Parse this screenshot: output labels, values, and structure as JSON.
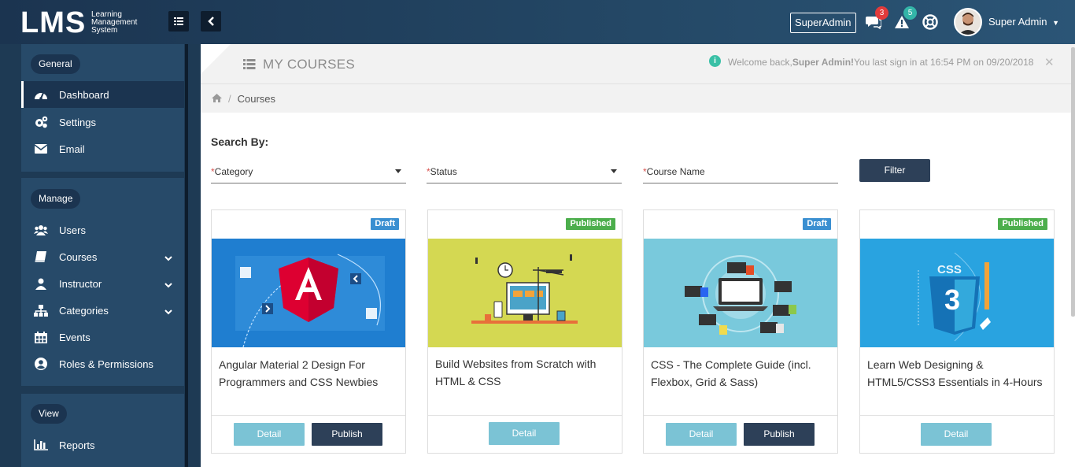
{
  "brand": {
    "logo": "LMS",
    "tagline": [
      "Learning",
      "Management",
      "System"
    ]
  },
  "topbar": {
    "role_label": "SuperAdmin",
    "messages_count": "3",
    "alerts_count": "5",
    "user_name": "Super Admin",
    "colors": {
      "messages_badge": "#e23b3b",
      "alerts_badge": "#33b5a8"
    }
  },
  "sidebar": {
    "groups": [
      {
        "title": "General",
        "items": [
          {
            "label": "Dashboard",
            "icon": "dashboard-icon",
            "active": true
          },
          {
            "label": "Settings",
            "icon": "gears-icon"
          },
          {
            "label": "Email",
            "icon": "envelope-icon"
          }
        ]
      },
      {
        "title": "Manage",
        "items": [
          {
            "label": "Users",
            "icon": "users-icon"
          },
          {
            "label": "Courses",
            "icon": "book-icon",
            "has_children": true
          },
          {
            "label": "Instructor",
            "icon": "user-icon",
            "has_children": true
          },
          {
            "label": "Categories",
            "icon": "sitemap-icon",
            "has_children": true
          },
          {
            "label": "Events",
            "icon": "calendar-icon"
          },
          {
            "label": "Roles & Permissions",
            "icon": "user-circle-icon"
          }
        ]
      },
      {
        "title": "View",
        "items": [
          {
            "label": "Reports",
            "icon": "bar-chart-icon"
          }
        ]
      }
    ]
  },
  "header": {
    "title": "MY COURSES",
    "welcome_prefix": "Welcome back,",
    "welcome_user": "Super Admin!",
    "welcome_suffix": "You last sign in at 16:54 PM on 09/20/2018"
  },
  "breadcrumb": {
    "current": "Courses"
  },
  "search": {
    "heading": "Search By:",
    "category_label": "Category",
    "status_label": "Status",
    "course_name_label": "Course Name",
    "required_mark": "*",
    "filter_label": "Filter"
  },
  "courses": [
    {
      "title": "Angular Material 2 Design For Programmers and CSS Newbies",
      "status": "Draft",
      "detail_label": "Detail",
      "publish_label": "Publish",
      "status_color": "#3a8fd1"
    },
    {
      "title": "Build Websites from Scratch with HTML & CSS",
      "status": "Published",
      "detail_label": "Detail",
      "status_color": "#4cae4c"
    },
    {
      "title": "CSS - The Complete Guide (incl. Flexbox, Grid & Sass)",
      "status": "Draft",
      "detail_label": "Detail",
      "publish_label": "Publish",
      "status_color": "#3a8fd1"
    },
    {
      "title": "Learn Web Designing & HTML5/CSS3 Essentials in 4-Hours",
      "status": "Published",
      "detail_label": "Detail",
      "status_color": "#4cae4c"
    }
  ]
}
